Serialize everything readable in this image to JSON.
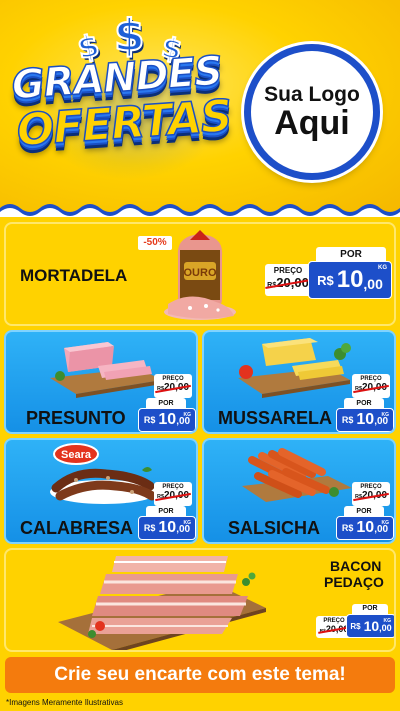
{
  "header": {
    "dollar_signs": [
      "$",
      "$",
      "$"
    ],
    "title_line1": "GRANDES",
    "title_line2": "OFERTAS",
    "logo_line1": "Sua Logo",
    "logo_line2": "Aqui"
  },
  "colors": {
    "background_yellow": "#ffd200",
    "royal_blue": "#1d4fc9",
    "card_blue": "#1da3f0",
    "cta_orange": "#f47b0d",
    "discount_red": "#e53b1c"
  },
  "products": [
    {
      "id": "mortadela",
      "name": "MORTADELA",
      "discount": "-50%",
      "brand_label": "OURO",
      "old_label": "PREÇO",
      "old_currency": "R$",
      "old_price": "20,00",
      "new_label": "POR",
      "currency": "R$",
      "price_int": "10",
      "price_dec": ",00",
      "unit": "KG"
    },
    {
      "id": "presunto",
      "name": "PRESUNTO",
      "old_label": "PREÇO",
      "old_currency": "R$",
      "old_price": "20,00",
      "new_label": "POR",
      "currency": "R$",
      "price_int": "10",
      "price_dec": ",00",
      "unit": "KG"
    },
    {
      "id": "mussarela",
      "name": "MUSSARELA",
      "old_label": "PREÇO",
      "old_currency": "R$",
      "old_price": "20,00",
      "new_label": "POR",
      "currency": "R$",
      "price_int": "10",
      "price_dec": ",00",
      "unit": "KG"
    },
    {
      "id": "calabresa",
      "name": "CALABRESA",
      "brand_label": "Seara",
      "old_label": "PREÇO",
      "old_currency": "R$",
      "old_price": "20,00",
      "new_label": "POR",
      "currency": "R$",
      "price_int": "10",
      "price_dec": ",00",
      "unit": "KG"
    },
    {
      "id": "salsicha",
      "name": "SALSICHA",
      "old_label": "PREÇO",
      "old_currency": "R$",
      "old_price": "20,00",
      "new_label": "POR",
      "currency": "R$",
      "price_int": "10",
      "price_dec": ",00",
      "unit": "KG"
    },
    {
      "id": "bacon",
      "name_line1": "BACON",
      "name_line2": "PEDAÇO",
      "old_label": "PREÇO",
      "old_currency": "R$",
      "old_price": "20,00",
      "new_label": "POR",
      "currency": "R$",
      "price_int": "10",
      "price_dec": ",00",
      "unit": "KG"
    }
  ],
  "footer": {
    "cta": "Crie seu encarte com este tema!",
    "disclaimer": "*Imagens Meramente Ilustrativas"
  }
}
